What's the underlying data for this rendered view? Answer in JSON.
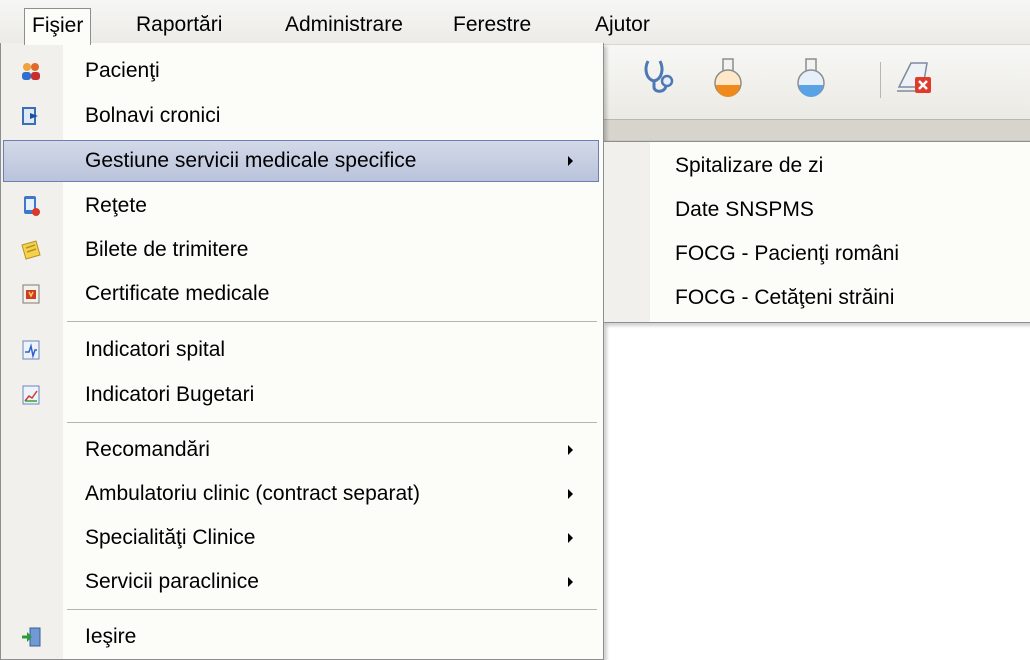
{
  "menubar": {
    "items": [
      {
        "label": "Fişier"
      },
      {
        "label": "Raportări"
      },
      {
        "label": "Administrare"
      },
      {
        "label": "Ferestre"
      },
      {
        "label": "Ajutor"
      }
    ]
  },
  "file_menu": {
    "items": [
      {
        "label": "Pacienţi",
        "icon": "patients-icon"
      },
      {
        "label": "Bolnavi cronici",
        "icon": "chronic-patients-icon"
      },
      {
        "label": "Gestiune servicii medicale specifice",
        "icon": "none",
        "submenu": true
      },
      {
        "label": "Reţete",
        "icon": "prescription-icon"
      },
      {
        "label": "Bilete de trimitere",
        "icon": "referral-icon"
      },
      {
        "label": "Certificate medicale",
        "icon": "certificate-icon"
      },
      {
        "label": "Indicatori spital",
        "icon": "hospital-indicators-icon"
      },
      {
        "label": "Indicatori Bugetari",
        "icon": "budget-indicators-icon"
      },
      {
        "label": "Recomandări",
        "submenu": true
      },
      {
        "label": "Ambulatoriu clinic (contract separat)",
        "submenu": true
      },
      {
        "label": "Specialităţi Clinice",
        "submenu": true
      },
      {
        "label": "Servicii paraclinice",
        "submenu": true
      },
      {
        "label": "Ieşire",
        "icon": "exit-icon"
      }
    ]
  },
  "submenu": {
    "items": [
      {
        "label": "Spitalizare de zi"
      },
      {
        "label": "Date SNSPMS"
      },
      {
        "label": "FOCG - Pacienţi români"
      },
      {
        "label": "FOCG - Cetăţeni străini"
      }
    ]
  },
  "colors": {
    "highlight": "#c2cbe0",
    "highlight_border": "#6c7fae",
    "menu_bg": "#fcfcf9",
    "gutter": "#f1f0ec"
  }
}
